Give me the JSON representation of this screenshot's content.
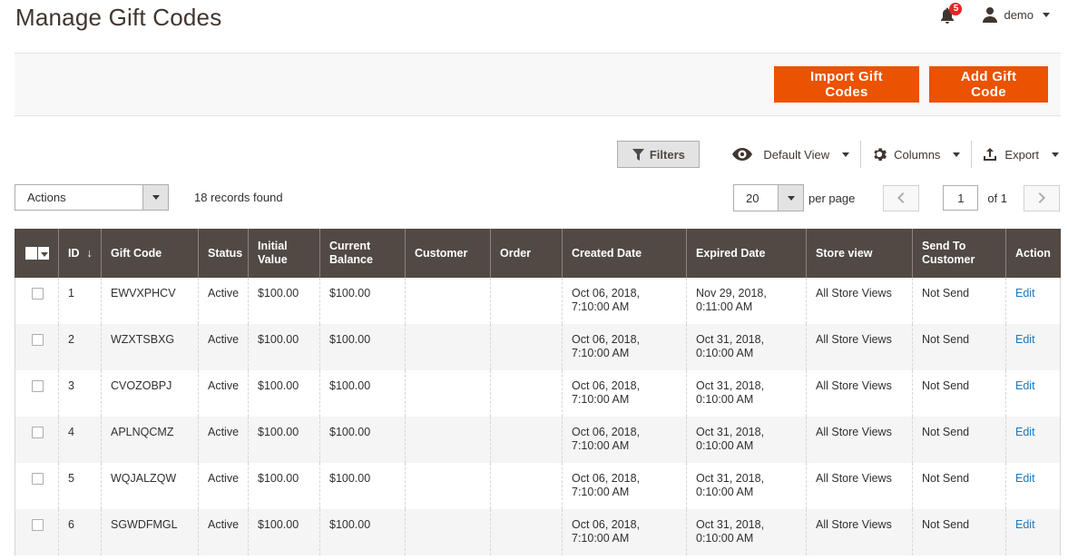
{
  "page": {
    "title": "Manage Gift Codes"
  },
  "header": {
    "notifications_count": "5",
    "user_name": "demo"
  },
  "action_bar": {
    "import_label": "Import Gift Codes",
    "add_label": "Add Gift Code"
  },
  "toolbar": {
    "filters_label": "Filters",
    "view_label": "Default View",
    "columns_label": "Columns",
    "export_label": "Export"
  },
  "mass_actions": {
    "label": "Actions"
  },
  "records_found": "18 records found",
  "pager": {
    "per_page_value": "20",
    "per_page_label": "per page",
    "current_page": "1",
    "total_label": "of 1"
  },
  "colors": {
    "accent": "#eb5202",
    "header_bg": "#514943",
    "link": "#1979c3"
  },
  "grid": {
    "columns": [
      "ID",
      "Gift Code",
      "Status",
      "Initial Value",
      "Current Balance",
      "Customer",
      "Order",
      "Created Date",
      "Expired Date",
      "Store view",
      "Send To Customer",
      "Action"
    ],
    "sort_indicator": "↓",
    "rows": [
      {
        "id": "1",
        "code": "EWVXPHCV",
        "status": "Active",
        "initial": "$100.00",
        "balance": "$100.00",
        "customer": "",
        "order": "",
        "created": "Oct 06, 2018, 7:10:00 AM",
        "expired": "Nov 29, 2018, 0:11:00 AM",
        "store": "All Store Views",
        "send": "Not Send",
        "action": "Edit"
      },
      {
        "id": "2",
        "code": "WZXTSBXG",
        "status": "Active",
        "initial": "$100.00",
        "balance": "$100.00",
        "customer": "",
        "order": "",
        "created": "Oct 06, 2018, 7:10:00 AM",
        "expired": "Oct 31, 2018, 0:10:00 AM",
        "store": "All Store Views",
        "send": "Not Send",
        "action": "Edit"
      },
      {
        "id": "3",
        "code": "CVOZOBPJ",
        "status": "Active",
        "initial": "$100.00",
        "balance": "$100.00",
        "customer": "",
        "order": "",
        "created": "Oct 06, 2018, 7:10:00 AM",
        "expired": "Oct 31, 2018, 0:10:00 AM",
        "store": "All Store Views",
        "send": "Not Send",
        "action": "Edit"
      },
      {
        "id": "4",
        "code": "APLNQCMZ",
        "status": "Active",
        "initial": "$100.00",
        "balance": "$100.00",
        "customer": "",
        "order": "",
        "created": "Oct 06, 2018, 7:10:00 AM",
        "expired": "Oct 31, 2018, 0:10:00 AM",
        "store": "All Store Views",
        "send": "Not Send",
        "action": "Edit"
      },
      {
        "id": "5",
        "code": "WQJALZQW",
        "status": "Active",
        "initial": "$100.00",
        "balance": "$100.00",
        "customer": "",
        "order": "",
        "created": "Oct 06, 2018, 7:10:00 AM",
        "expired": "Oct 31, 2018, 0:10:00 AM",
        "store": "All Store Views",
        "send": "Not Send",
        "action": "Edit"
      },
      {
        "id": "6",
        "code": "SGWDFMGL",
        "status": "Active",
        "initial": "$100.00",
        "balance": "$100.00",
        "customer": "",
        "order": "",
        "created": "Oct 06, 2018, 7:10:00 AM",
        "expired": "Oct 31, 2018, 0:10:00 AM",
        "store": "All Store Views",
        "send": "Not Send",
        "action": "Edit"
      }
    ]
  }
}
